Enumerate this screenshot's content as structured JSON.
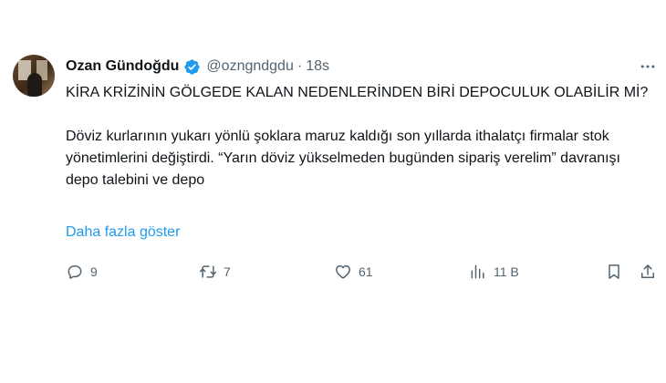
{
  "author": {
    "name": "Ozan Gündoğdu",
    "handle": "@ozngndgdu",
    "separator": "·",
    "time": "18s",
    "verified_color": "#1d9bf0"
  },
  "tweet": {
    "paragraph1": "KİRA KRİZİNİN GÖLGEDE KALAN NEDENLERİNDEN BİRİ DEPOCULUK OLABİLİR Mİ?",
    "paragraph2": "Döviz kurlarının yukarı yönlü şoklara maruz kaldığı son yıllarda ithalatçı firmalar stok yönetimlerini değiştirdi. “Yarın döviz yükselmeden bugünden sipariş verelim” davranışı depo talebini ve depo",
    "show_more": "Daha fazla göster"
  },
  "actions": {
    "reply_count": "9",
    "retweet_count": "7",
    "like_count": "61",
    "views_count": "11 B"
  },
  "icons": {
    "verified": "verified-badge-icon",
    "more": "more-dots-icon",
    "reply": "reply-bubble-icon",
    "retweet": "retweet-icon",
    "like": "heart-icon",
    "views": "views-bars-icon",
    "bookmark": "bookmark-icon",
    "share": "share-icon"
  },
  "colors": {
    "link": "#1d9bf0",
    "muted": "#536471",
    "text": "#0f1419"
  }
}
